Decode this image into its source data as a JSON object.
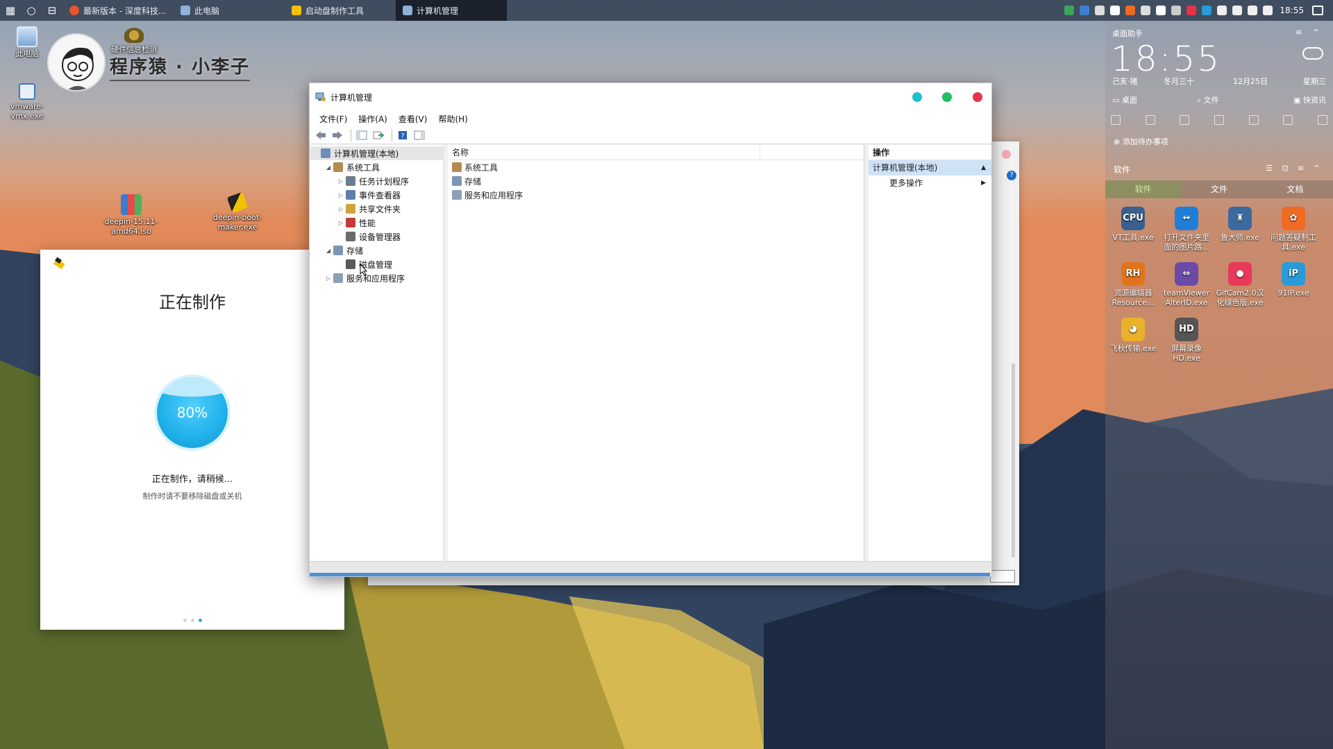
{
  "taskbar": {
    "tasks": [
      {
        "label": "最新版本 - 深度科技...",
        "color": "#e9542f"
      },
      {
        "label": "此电脑",
        "color": "#8fb2d9"
      },
      {
        "label": "启动盘制作工具",
        "color": "#f2c200"
      },
      {
        "label": "计算机管理",
        "color": "#8fb2d9"
      }
    ],
    "time": "18:55"
  },
  "desktop": {
    "icons": [
      {
        "label": "此电脑"
      },
      {
        "label": "vmware-vmx.exe"
      },
      {
        "label": "deepin-15.11-amd64.iso"
      },
      {
        "label": "deepin-boot-maker.exe"
      }
    ],
    "logo_text": "程序猿 · 小李子",
    "logo_overlay": "硬件信息检测"
  },
  "maker": {
    "title": "正在制作",
    "progress_label": "80%",
    "progress_value": 0.8,
    "status": "正在制作，请稍候...",
    "hint": "制作时请不要移除磁盘或关机"
  },
  "mmc": {
    "title": "计算机管理",
    "menu": [
      "文件(F)",
      "操作(A)",
      "查看(V)",
      "帮助(H)"
    ],
    "tree": [
      {
        "label": "计算机管理(本地)",
        "level": 0,
        "twisty": "",
        "color": "#6d8fb8",
        "icon": "computer-icon",
        "selected": true
      },
      {
        "label": "系统工具",
        "level": 1,
        "twisty": "◢",
        "color": "#b48a50",
        "icon": "tools-icon"
      },
      {
        "label": "任务计划程序",
        "level": 2,
        "twisty": "▷",
        "color": "#6c7d8f",
        "icon": "clock-icon"
      },
      {
        "label": "事件查看器",
        "level": 2,
        "twisty": "▷",
        "color": "#5e7fa8",
        "icon": "event-icon"
      },
      {
        "label": "共享文件夹",
        "level": 2,
        "twisty": "▷",
        "color": "#d1a53a",
        "icon": "folder-icon"
      },
      {
        "label": "性能",
        "level": 2,
        "twisty": "▷",
        "color": "#c23b3b",
        "icon": "performance-icon"
      },
      {
        "label": "设备管理器",
        "level": 2,
        "twisty": "",
        "color": "#6b6b6b",
        "icon": "device-icon"
      },
      {
        "label": "存储",
        "level": 1,
        "twisty": "◢",
        "color": "#7d96b3",
        "icon": "storage-icon"
      },
      {
        "label": "磁盘管理",
        "level": 2,
        "twisty": "",
        "color": "#5a5a5a",
        "icon": "disk-icon"
      },
      {
        "label": "服务和应用程序",
        "level": 1,
        "twisty": "▷",
        "color": "#8aa0b8",
        "icon": "services-icon"
      }
    ],
    "column_name": "名称",
    "rows": [
      {
        "label": "系统工具",
        "color": "#b48a50",
        "icon": "tools-icon"
      },
      {
        "label": "存储",
        "color": "#7d96b3",
        "icon": "storage-icon"
      },
      {
        "label": "服务和应用程序",
        "color": "#8aa0b8",
        "icon": "services-icon"
      }
    ],
    "actions_header": "操作",
    "actions_selected": "计算机管理(本地)",
    "actions_more": "更多操作"
  },
  "assistant": {
    "title": "桌面助手",
    "clock": "18:55",
    "lunar_year": "己亥·猪",
    "lunar_day": "冬月三十",
    "date": "12月25日",
    "weekday": "星期三",
    "quick": [
      "桌面",
      "文件",
      "快资讯"
    ],
    "todo": "添加待办事项",
    "software_title": "软件",
    "tabs": [
      "软件",
      "文件",
      "文档"
    ],
    "apps": [
      {
        "label": "VT工具.exe",
        "glyph": "CPU",
        "color": "#3b5f8e"
      },
      {
        "label": "打开文件夹里面的图片路...",
        "glyph": "↔",
        "color": "#1f7fd8"
      },
      {
        "label": "鲁大师.exe",
        "glyph": "♜",
        "color": "#3a6aa0"
      },
      {
        "label": "问题答疑制工具.exe",
        "glyph": "✿",
        "color": "#ef6a22"
      },
      {
        "label": "资源编辑器Resource...",
        "glyph": "RH",
        "color": "#e2731d"
      },
      {
        "label": "teamViewer AlterID.exe",
        "glyph": "⇔",
        "color": "#6b4aa8"
      },
      {
        "label": "GifCam2.0汉化绿色版.exe",
        "glyph": "●",
        "color": "#e8395a"
      },
      {
        "label": "91IP.exe",
        "glyph": "iP",
        "color": "#2a9ad8"
      },
      {
        "label": "飞秋传输.exe",
        "glyph": "◕",
        "color": "#e9b22a"
      },
      {
        "label": "屏幕录像HD.exe",
        "glyph": "HD",
        "color": "#555555"
      }
    ]
  },
  "colors": {
    "accent": "#2ca7f8",
    "progress": "#1fb0ea",
    "close": "#e8324a",
    "minimize": "#1fbfc9",
    "maximize": "#1fbf5f",
    "selection": "#cfe3f7"
  }
}
